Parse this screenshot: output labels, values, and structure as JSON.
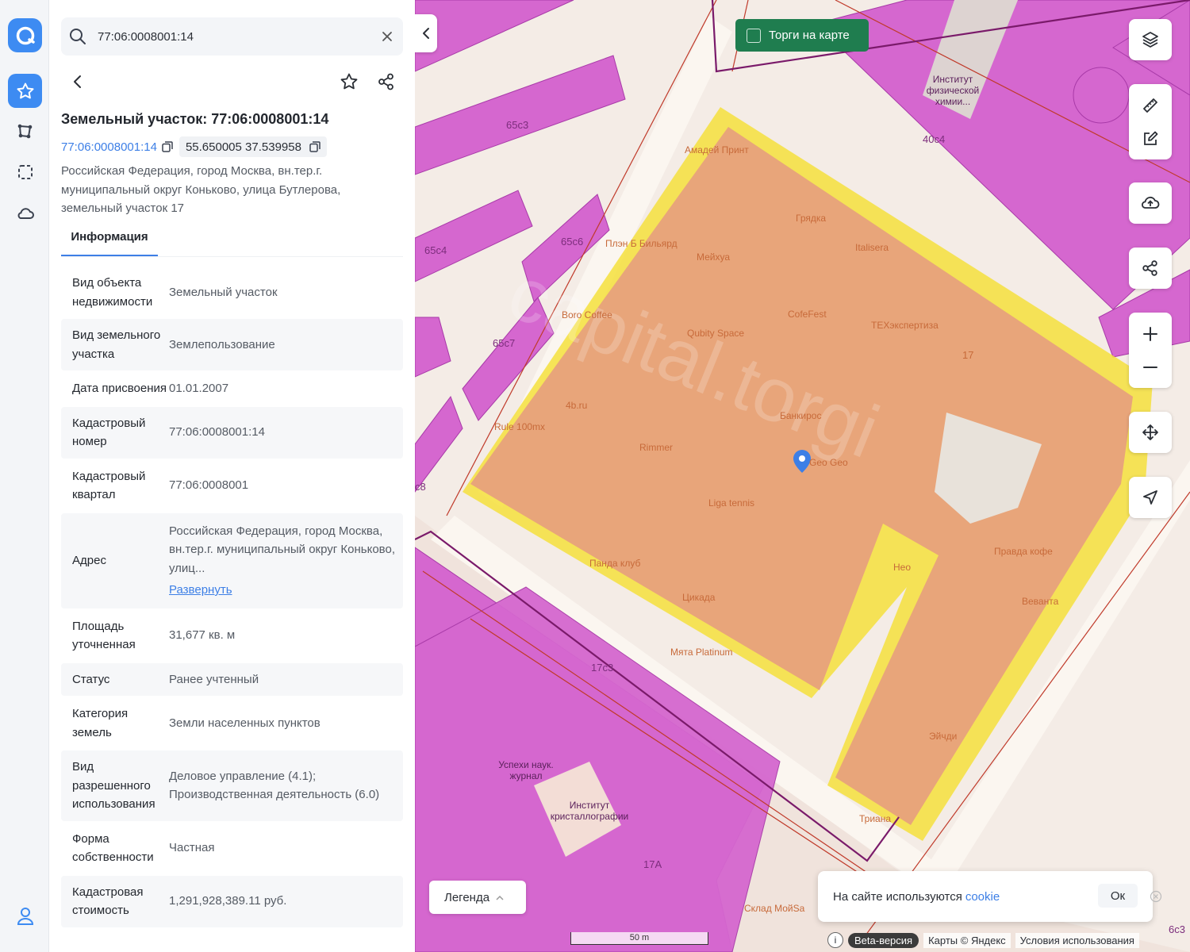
{
  "rail": {
    "items": [
      {
        "name": "favorites",
        "active": true
      },
      {
        "name": "route"
      },
      {
        "name": "select-area"
      },
      {
        "name": "cloud"
      }
    ]
  },
  "search": {
    "value": "77:06:0008001:14",
    "placeholder": ""
  },
  "parcel": {
    "title": "Земельный участок: 77:06:0008001:14",
    "cadastral_link": "77:06:0008001:14",
    "coordinates": "55.650005 37.539958",
    "address": "Российская Федерация, город Москва, вн.тер.г. муниципальный округ Коньково, улица Бутлерова, земельный участок 17"
  },
  "tabs": {
    "info": "Информация"
  },
  "rows": [
    {
      "k": "Вид объекта недвижимости",
      "v": "Земельный участок"
    },
    {
      "k": "Вид земельного участка",
      "v": "Землепользование"
    },
    {
      "k": "Дата присвоения",
      "v": "01.01.2007"
    },
    {
      "k": "Кадастровый номер",
      "v": "77:06:0008001:14"
    },
    {
      "k": "Кадастровый квартал",
      "v": "77:06:0008001"
    },
    {
      "k": "Адрес",
      "v": "Российская Федерация, город Москва, вн.тер.г. муниципальный округ Коньково, улиц...",
      "link": "Развернуть"
    },
    {
      "k": "Площадь уточненная",
      "v": "31,677 кв. м"
    },
    {
      "k": "Статус",
      "v": "Ранее учтенный"
    },
    {
      "k": "Категория земель",
      "v": "Земли населенных пунктов"
    },
    {
      "k": "Вид разрешенного использования",
      "v": "Деловое управление (4.1); Производственная деятельность (6.0)"
    },
    {
      "k": "Форма собственности",
      "v": "Частная"
    },
    {
      "k": "Кадастровая стоимость",
      "v": "1,291,928,389.11 руб."
    }
  ],
  "map": {
    "torgi_label": "Торги на карте",
    "legend_label": "Легенда",
    "cookie_text": "На сайте используются",
    "cookie_link": "cookie",
    "cookie_ok": "Ок",
    "scale": "50 m",
    "beta": "Beta-версия",
    "attribution": "Карты © Яндекс",
    "terms": "Условия использования",
    "building_labels": [
      "65с3",
      "65с4",
      "65с6",
      "65с7",
      "40с4",
      "17",
      "17с3",
      "17А",
      "с8",
      "6с3"
    ],
    "poi": [
      "Амадей Принт",
      "Грядка",
      "Italisera",
      "Плэн Б Бильярд",
      "Мейхуа",
      "Boro Coffee",
      "CofeFest",
      "ТЕХэкспертиза",
      "Qubity Space",
      "4b.ru",
      "Банкирос",
      "Rule 100mx",
      "Rimmer",
      "Geo Geo",
      "Liga tennis",
      "Панда клуб",
      "Цикада",
      "Мята Platinum",
      "Heo",
      "Правда кофе",
      "Веванта",
      "Эйчди",
      "Триана",
      "Успехи наук. журнал",
      "Институт кристаллографии",
      "Институт физической химии...",
      "Склад МойSa"
    ],
    "colors": {
      "zone": "#d567cf",
      "parcel": "#e8a57a",
      "road": "#fbf6f0",
      "border": "#f5e13c",
      "accent": "#3d8bf2"
    }
  }
}
